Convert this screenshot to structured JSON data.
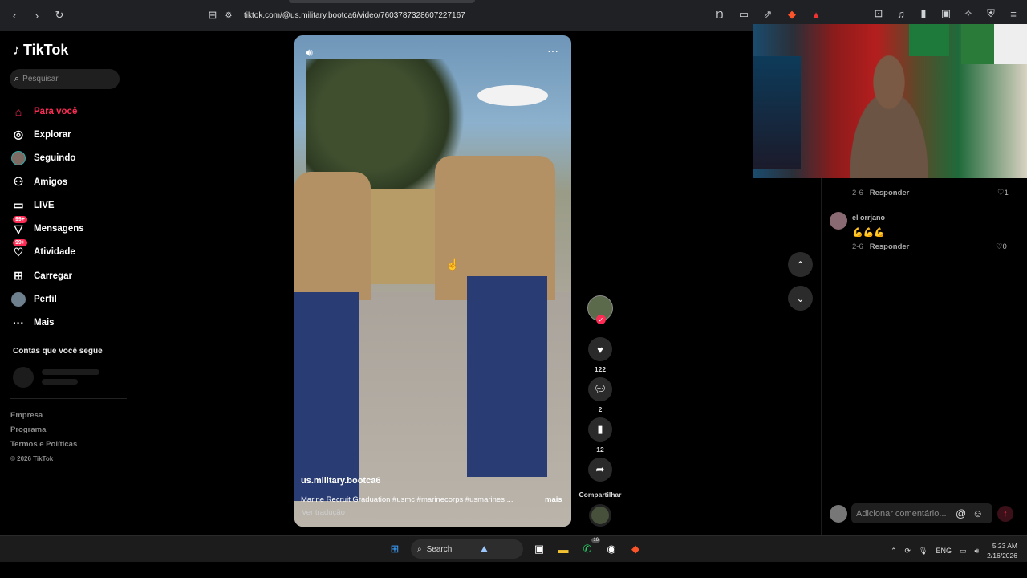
{
  "browser": {
    "url": "tiktok.com/@us.military.bootca6/video/7603787328607227167"
  },
  "sidebar": {
    "logo": "TikTok",
    "search_placeholder": "Pesquisar",
    "items": [
      {
        "label": "Para você",
        "icon": "home-icon",
        "active": true
      },
      {
        "label": "Explorar",
        "icon": "compass-icon"
      },
      {
        "label": "Seguindo",
        "icon": "following-avatar-icon"
      },
      {
        "label": "Amigos",
        "icon": "friends-icon"
      },
      {
        "label": "LIVE",
        "icon": "live-icon"
      },
      {
        "label": "Mensagens",
        "icon": "messages-icon",
        "badge": "99+"
      },
      {
        "label": "Atividade",
        "icon": "activity-icon",
        "badge": "99+"
      },
      {
        "label": "Carregar",
        "icon": "upload-icon"
      },
      {
        "label": "Perfil",
        "icon": "profile-avatar-icon"
      },
      {
        "label": "Mais",
        "icon": "more-icon"
      }
    ],
    "following_header": "Contas que você segue",
    "footer": {
      "company": "Empresa",
      "program": "Programa",
      "terms": "Termos e Políticas",
      "copyright": "© 2026 TikTok"
    }
  },
  "video": {
    "username": "us.military.bootca6",
    "description": "Marine Recruit Graduation #usmc #marinecorps #usmarines ...",
    "more_label": "mais",
    "translate_label": "Ver tradução"
  },
  "actions": {
    "likes": "122",
    "comments": "2",
    "saves": "12",
    "share_label": "Compartilhar"
  },
  "comments": {
    "list": [
      {
        "date": "2-6",
        "reply": "Responder",
        "likes": "1"
      },
      {
        "name": "el orrjano",
        "text": "💪💪💪",
        "date": "2-6",
        "reply": "Responder",
        "likes": "0"
      }
    ],
    "input_placeholder": "Adicionar comentário..."
  },
  "taskbar": {
    "search_label": "Search",
    "whatsapp_badge": "16",
    "lang": "ENG",
    "time": "5:23 AM",
    "date": "2/16/2026"
  }
}
